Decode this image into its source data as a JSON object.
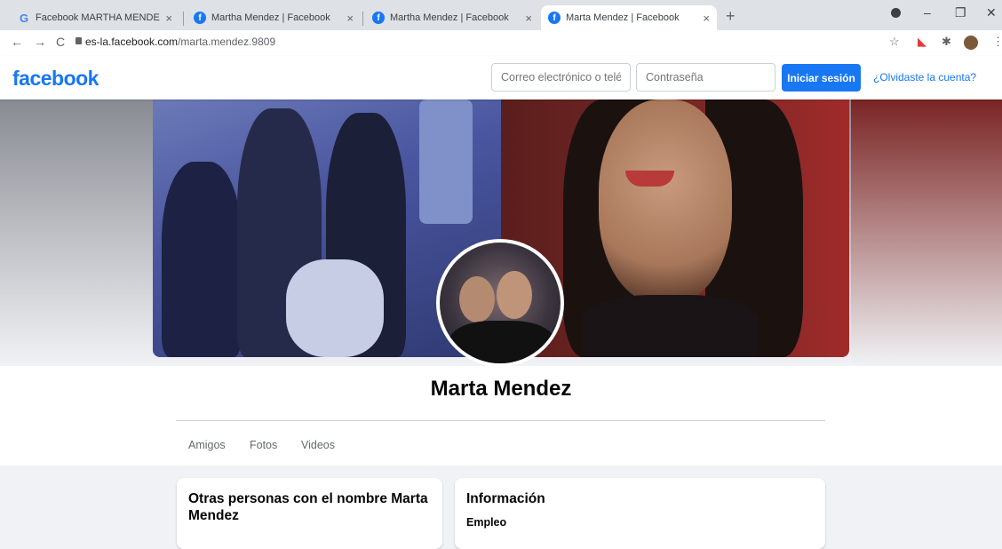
{
  "browser": {
    "tabs": [
      {
        "title": "Facebook MARTHA MENDEZ SO",
        "favicon": "google-icon"
      },
      {
        "title": "Martha Mendez | Facebook",
        "favicon": "facebook-icon"
      },
      {
        "title": "Martha Mendez | Facebook",
        "favicon": "facebook-icon"
      },
      {
        "title": "Marta Mendez | Facebook",
        "favicon": "facebook-icon",
        "active": true
      }
    ],
    "url_host": "es-la.facebook.com",
    "url_path": "/marta.mendez.9809"
  },
  "header": {
    "logo": "facebook",
    "email_placeholder": "Correo electrónico o telé",
    "password_placeholder": "Contraseña",
    "login_label": "Iniciar sesión",
    "forgot_label": "¿Olvidaste la cuenta?"
  },
  "profile": {
    "name": "Marta Mendez",
    "nav": [
      "Amigos",
      "Fotos",
      "Videos"
    ]
  },
  "cards": {
    "others_title": "Otras personas con el nombre Marta Mendez",
    "info_title": "Información",
    "info_sub": "Empleo"
  },
  "colors": {
    "brand": "#1877f2",
    "background": "#f0f2f5"
  }
}
